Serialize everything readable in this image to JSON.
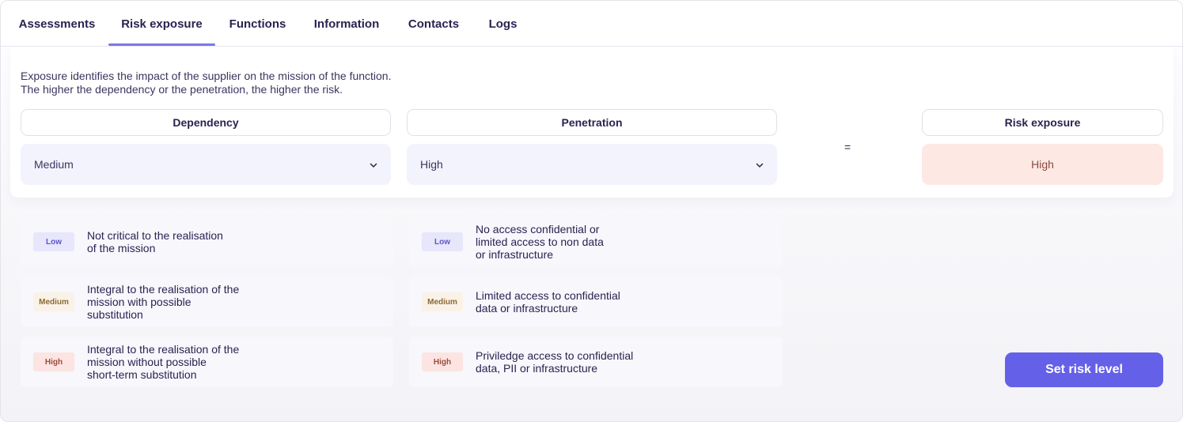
{
  "tabs": [
    {
      "label": "Assessments"
    },
    {
      "label": "Risk exposure",
      "active": true
    },
    {
      "label": "Functions"
    },
    {
      "label": "Information"
    },
    {
      "label": "Contacts"
    },
    {
      "label": "Logs"
    }
  ],
  "description": {
    "line1": "Exposure identifies the impact of the supplier on the mission of the function.",
    "line2": "The higher the dependency or the penetration, the higher the risk."
  },
  "dependency": {
    "header": "Dependency",
    "value": "Medium",
    "icon": "chevron-down-icon"
  },
  "penetration": {
    "header": "Penetration",
    "value": "High",
    "icon": "chevron-down-icon"
  },
  "operator": "=",
  "risk_exposure": {
    "header": "Risk exposure",
    "value": "High"
  },
  "dependency_levels": [
    {
      "badge": "Low",
      "text": "Not critical to the realisation\nof the mission"
    },
    {
      "badge": "Medium",
      "text": "Integral to the realisation of the\nmission with possible\nsubstitution"
    },
    {
      "badge": "High",
      "text": "Integral to the realisation of the\nmission without possible\nshort-term substitution"
    }
  ],
  "penetration_levels": [
    {
      "badge": "Low",
      "text": "No access confidential or\nlimited access to non data\nor infrastructure"
    },
    {
      "badge": "Medium",
      "text": "Limited access to confidential\ndata or infrastructure"
    },
    {
      "badge": "High",
      "text": "Priviledge access to confidential\ndata, PII or infrastructure"
    }
  ],
  "action": {
    "label": "Set risk level"
  },
  "colors": {
    "accent": "#6560e8",
    "tab_indicator": "#7c79e8",
    "high_bg": "#fde8e4",
    "select_bg": "#f3f3fd"
  }
}
